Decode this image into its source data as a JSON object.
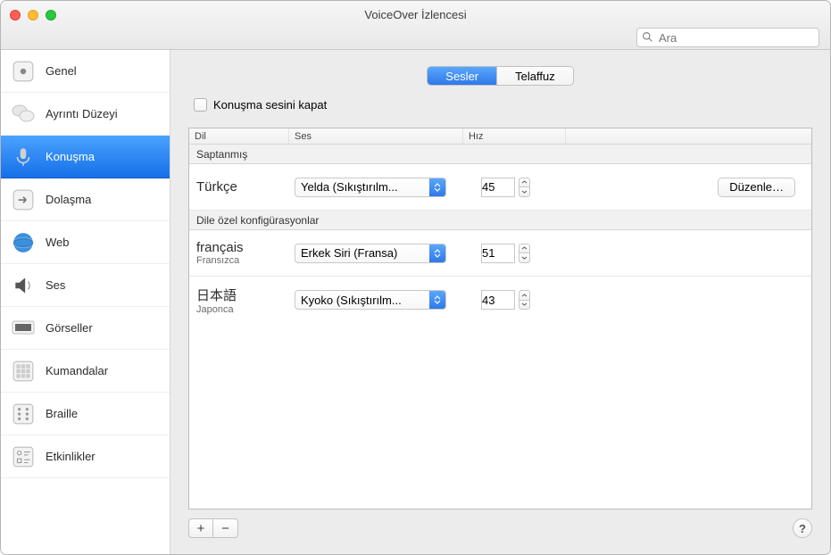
{
  "window": {
    "title": "VoiceOver İzlencesi"
  },
  "search": {
    "placeholder": "Ara"
  },
  "sidebar": {
    "items": [
      {
        "label": "Genel"
      },
      {
        "label": "Ayrıntı Düzeyi"
      },
      {
        "label": "Konuşma"
      },
      {
        "label": "Dolaşma"
      },
      {
        "label": "Web"
      },
      {
        "label": "Ses"
      },
      {
        "label": "Görseller"
      },
      {
        "label": "Kumandalar"
      },
      {
        "label": "Braille"
      },
      {
        "label": "Etkinlikler"
      }
    ]
  },
  "tabs": {
    "voices": "Sesler",
    "pronunciation": "Telaffuz"
  },
  "mute_label": "Konuşma sesini kapat",
  "columns": {
    "lang": "Dil",
    "voice": "Ses",
    "rate": "Hız"
  },
  "sections": {
    "default": "Saptanmış",
    "lang_specific": "Dile özel konfigürasyonlar"
  },
  "default_row": {
    "language": "Türkçe",
    "voice": "Yelda (Sıkıştırılm...",
    "rate": "45",
    "edit_label": "Düzenle…"
  },
  "lang_rows": [
    {
      "native": "français",
      "translated": "Fransızca",
      "voice": "Erkek Siri (Fransa)",
      "rate": "51"
    },
    {
      "native": "日本語",
      "translated": "Japonca",
      "voice": "Kyoko (Sıkıştırılm...",
      "rate": "43"
    }
  ],
  "footer": {
    "add": "+",
    "remove": "−",
    "help": "?"
  }
}
